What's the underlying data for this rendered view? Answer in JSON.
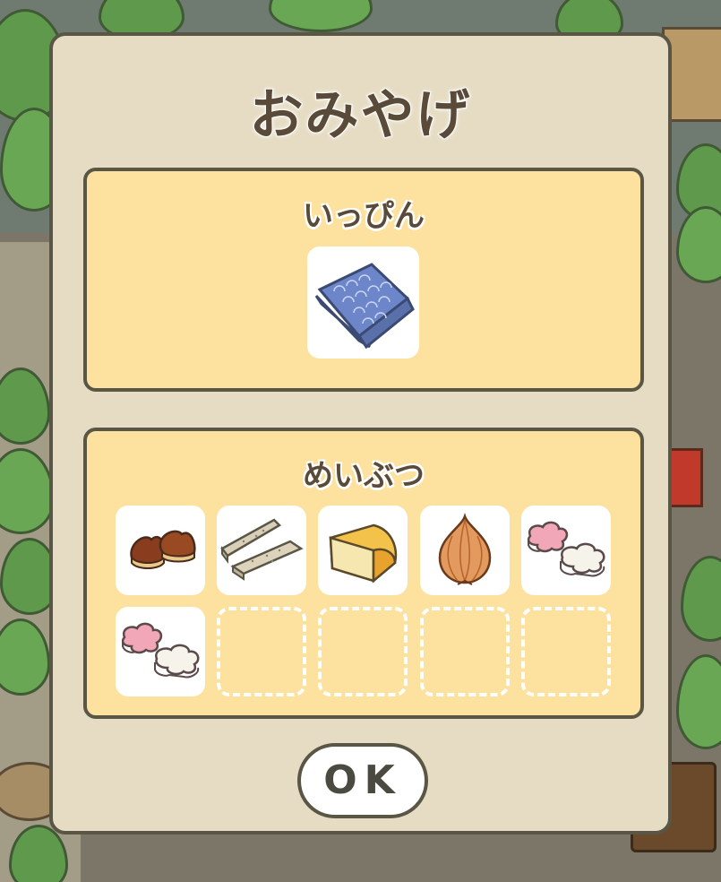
{
  "dialog": {
    "title": "おみやげ",
    "special": {
      "heading": "いっぴん",
      "item": {
        "icon": "blue-wrapping-cloth-icon"
      }
    },
    "local": {
      "heading": "めいぶつ",
      "items": [
        {
          "icon": "chestnuts-icon"
        },
        {
          "icon": "rice-cracker-bars-icon"
        },
        {
          "icon": "cheese-wedge-icon"
        },
        {
          "icon": "onion-icon"
        },
        {
          "icon": "flower-rice-cakes-icon"
        },
        {
          "icon": "flower-rice-cakes-icon"
        },
        {
          "icon": null
        },
        {
          "icon": null
        },
        {
          "icon": null
        },
        {
          "icon": null
        }
      ]
    },
    "ok_label": "OK"
  },
  "colors": {
    "dialog_bg": "#e6dcc3",
    "panel_bg": "#fde29f",
    "outline": "#5a5646",
    "text": "#5a4a3a"
  }
}
